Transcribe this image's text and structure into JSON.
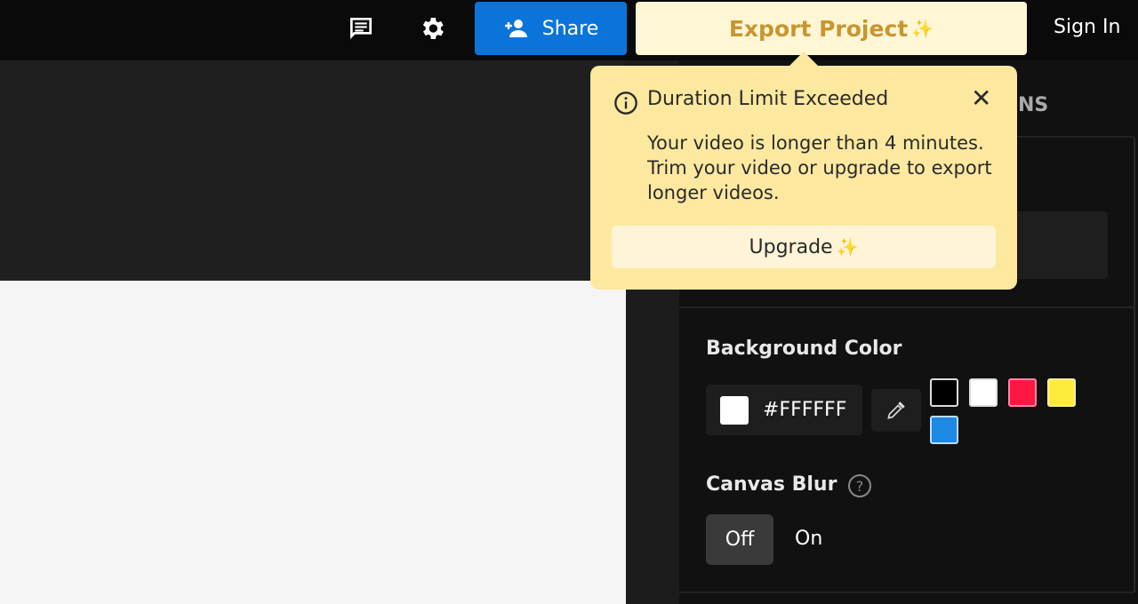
{
  "topbar": {
    "share_label": "Share",
    "export_label": "Export Project",
    "sparkle": "✨",
    "signin_label": "Sign In",
    "icons": [
      "comment-icon",
      "gear-icon",
      "add-person-icon"
    ]
  },
  "panel": {
    "tab_partial": "NS",
    "background_color": {
      "label": "Background Color",
      "hex": "#FFFFFF",
      "swatches": [
        "#000000",
        "#FFFFFF",
        "#FF1744",
        "#FFEB3B",
        "#1E88E5"
      ]
    },
    "canvas_blur": {
      "label": "Canvas Blur",
      "off": "Off",
      "on": "On",
      "selected": "Off"
    }
  },
  "popover": {
    "title": "Duration Limit Exceeded",
    "body": "Your video is longer than 4 minutes. Trim your video or upgrade to export longer videos.",
    "upgrade_label": "Upgrade",
    "close": "✕"
  }
}
